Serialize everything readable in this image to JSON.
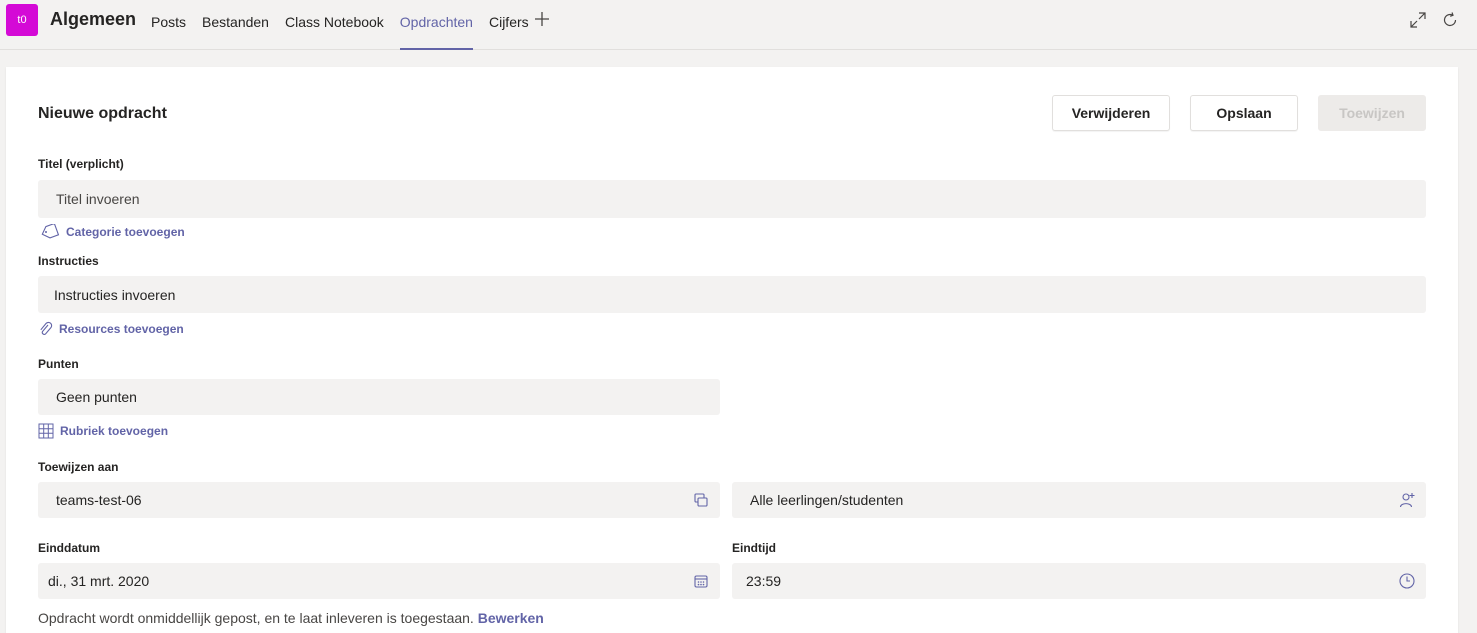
{
  "header": {
    "team_initials": "t0",
    "channel_name": "Algemeen",
    "tabs": [
      {
        "label": "Posts",
        "active": false
      },
      {
        "label": "Bestanden",
        "active": false
      },
      {
        "label": "Class Notebook",
        "active": false
      },
      {
        "label": "Opdrachten",
        "active": true
      },
      {
        "label": "Cijfers",
        "active": false
      }
    ],
    "icons": [
      "add-tab-icon",
      "expand-icon",
      "refresh-icon"
    ]
  },
  "form": {
    "title": "Nieuwe opdracht",
    "buttons": {
      "delete": "Verwijderen",
      "save": "Opslaan",
      "assign": "Toewijzen"
    },
    "title_field": {
      "label": "Titel (verplicht)",
      "placeholder": "Titel invoeren"
    },
    "category_link": "Categorie toevoegen",
    "instructions": {
      "label": "Instructies",
      "placeholder": "Instructies invoeren"
    },
    "resources_link": "Resources toevoegen",
    "points": {
      "label": "Punten",
      "value": "Geen punten"
    },
    "rubric_link": "Rubriek toevoegen",
    "assign_to": {
      "label": "Toewijzen aan",
      "class": "teams-test-06",
      "students": "Alle leerlingen/studenten"
    },
    "due_date": {
      "label": "Einddatum",
      "value": "di., 31 mrt. 2020"
    },
    "due_time": {
      "label": "Eindtijd",
      "value": "23:59"
    },
    "footer_note": "Opdracht wordt onmiddellijk gepost, en te laat inleveren is toegestaan.",
    "footer_edit": "Bewerken"
  },
  "colors": {
    "accent": "#6264a7",
    "team_avatar": "#d40ad6",
    "field_bg": "#f3f2f1"
  }
}
